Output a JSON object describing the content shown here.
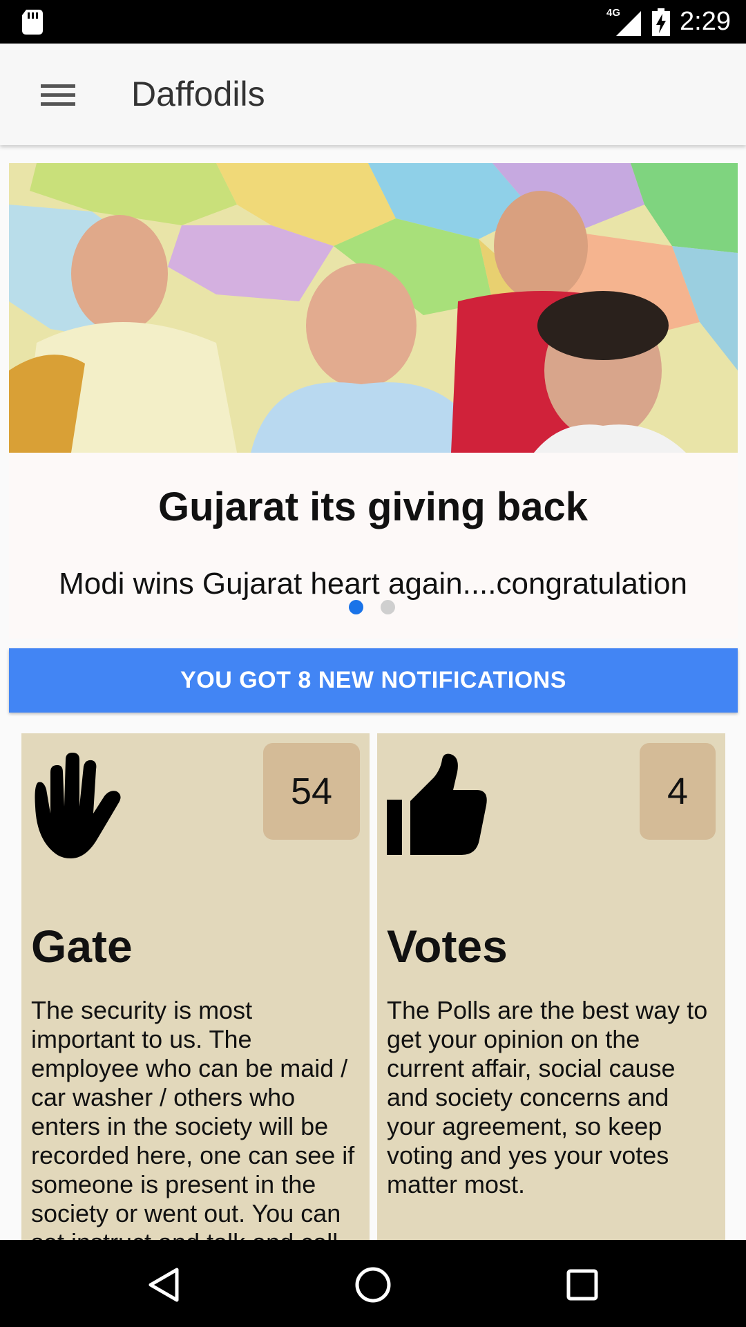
{
  "status_bar": {
    "network": "4G",
    "time": "2:29"
  },
  "app_bar": {
    "title": "Daffodils"
  },
  "carousel": {
    "slides": [
      {
        "title": "Gujarat its giving back",
        "subtitle": "Modi wins Gujarat heart again....congratulation"
      }
    ],
    "active_index": 0,
    "slide_count": 2,
    "colors": {
      "dot_active": "#1a73e8",
      "dot_inactive": "#cfcfcf"
    }
  },
  "notification": {
    "label": "YOU GOT 8 NEW NOTIFICATIONS",
    "color": "#4285f4"
  },
  "cards": [
    {
      "icon": "hand-icon",
      "count": "54",
      "title": "Gate",
      "description": "The security is most important to us. The employee who can be maid / car washer / others who enters in the society will be recorded here, one can see if someone is present in the society or went out. You can set instruct and talk and call"
    },
    {
      "icon": "thumbs-up-icon",
      "count": "4",
      "title": "Votes",
      "description": "The Polls are the best way to get your opinion on the current affair, social cause and society concerns and your agreement, so keep voting and yes your votes matter most."
    }
  ],
  "theme": {
    "card_bg": "#e2d8bb",
    "badge_bg": "#d4bb97"
  }
}
